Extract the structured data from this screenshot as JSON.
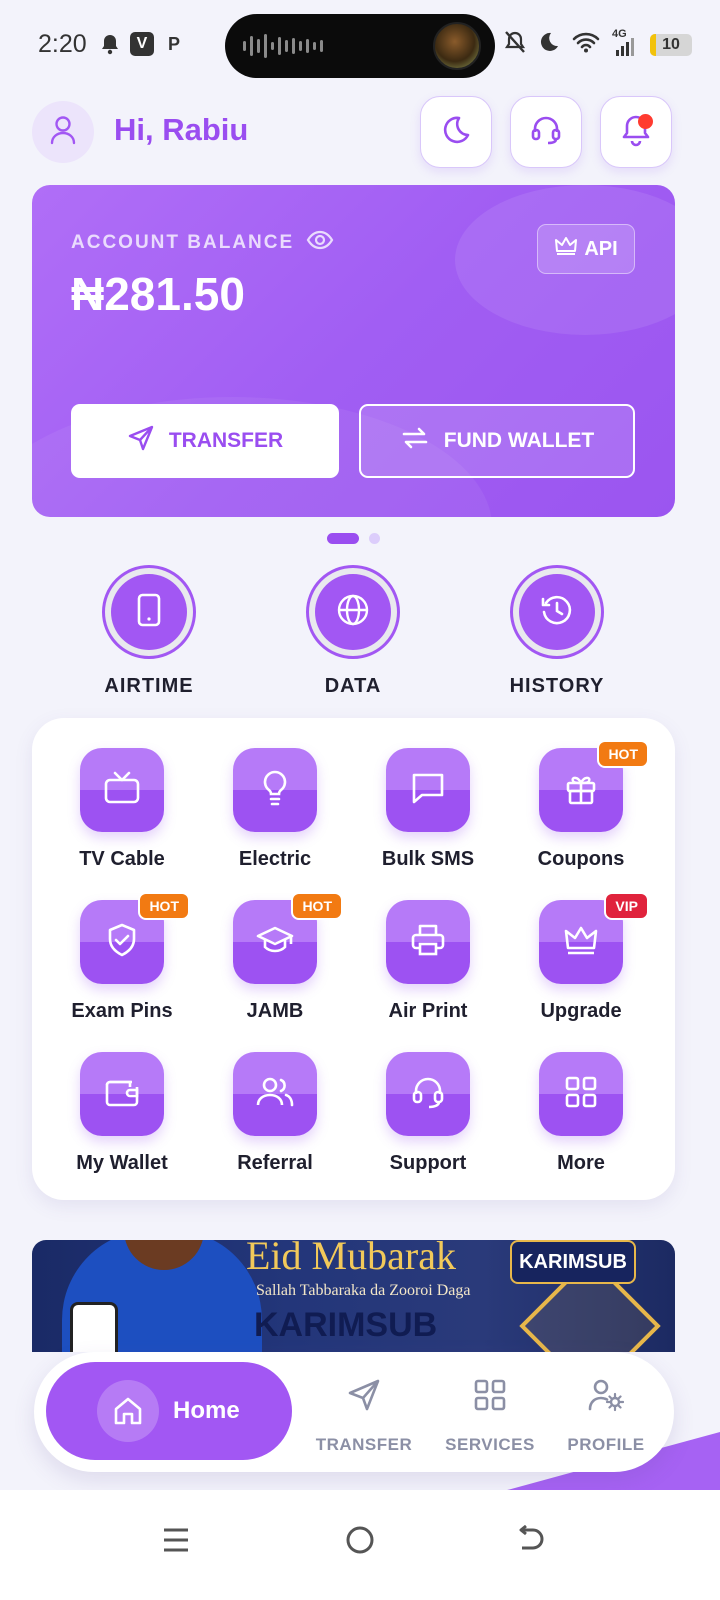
{
  "status_bar": {
    "time": "2:20",
    "left_icons": [
      "bell-icon",
      "v-app-icon",
      "p-app-icon"
    ],
    "right_icons": [
      "mute-icon",
      "moon-icon",
      "wifi-icon",
      "4g-signal-icon"
    ],
    "network": "4G",
    "battery": "10"
  },
  "header": {
    "greeting": "Hi, Rabiu",
    "buttons": [
      "moon-icon",
      "headset-icon",
      "bell-icon"
    ]
  },
  "balance": {
    "label": "ACCOUNT BALANCE",
    "amount": "₦281.50",
    "api_label": "API",
    "transfer_label": "TRANSFER",
    "fund_label": "FUND WALLET"
  },
  "carousel": {
    "pages": 2,
    "active": 1
  },
  "quick_actions": [
    {
      "label": "AIRTIME",
      "icon": "phone-icon"
    },
    {
      "label": "DATA",
      "icon": "globe-icon"
    },
    {
      "label": "HISTORY",
      "icon": "history-icon"
    }
  ],
  "services": [
    {
      "label": "TV Cable",
      "icon": "tv-icon",
      "tag": ""
    },
    {
      "label": "Electric",
      "icon": "lightbulb-icon",
      "tag": ""
    },
    {
      "label": "Bulk SMS",
      "icon": "message-icon",
      "tag": ""
    },
    {
      "label": "Coupons",
      "icon": "gift-icon",
      "tag": "HOT"
    },
    {
      "label": "Exam Pins",
      "icon": "shield-check-icon",
      "tag": "HOT"
    },
    {
      "label": "JAMB",
      "icon": "graduation-cap-icon",
      "tag": "HOT"
    },
    {
      "label": "Air Print",
      "icon": "printer-icon",
      "tag": ""
    },
    {
      "label": "Upgrade",
      "icon": "crown-icon",
      "tag": "VIP"
    },
    {
      "label": "My Wallet",
      "icon": "wallet-icon",
      "tag": ""
    },
    {
      "label": "Referral",
      "icon": "users-icon",
      "tag": ""
    },
    {
      "label": "Support",
      "icon": "headset-icon",
      "tag": ""
    },
    {
      "label": "More",
      "icon": "grid-icon",
      "tag": ""
    }
  ],
  "banner": {
    "title": "Eid Mubarak",
    "subtitle": "Sallah Tabbaraka da Zooroi Daga",
    "brand": "KARIMSUB",
    "badge": "KARIMSUB"
  },
  "bottom_nav": {
    "home": "Home",
    "items": [
      {
        "label": "TRANSFER",
        "icon": "send-icon"
      },
      {
        "label": "SERVICES",
        "icon": "grid-icon"
      },
      {
        "label": "PROFILE",
        "icon": "user-settings-icon"
      }
    ]
  },
  "colors": {
    "accent": "#a257f3",
    "accent_light": "#b67af8",
    "greeting": "#9a4df0",
    "hot_tag": "#f27a12",
    "vip_tag": "#e0233c",
    "background": "#f3f3fb"
  }
}
